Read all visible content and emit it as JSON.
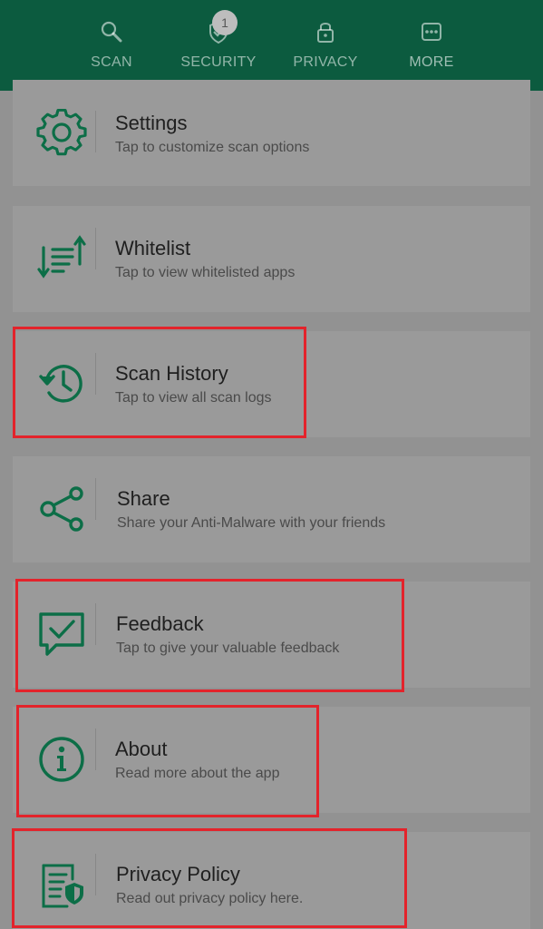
{
  "colors": {
    "accent": "#0c5b3f",
    "icon_green": "#0c6e47",
    "background_dimmed": "#929292",
    "highlight_red": "#e3232b"
  },
  "tabs": [
    {
      "label": "SCAN",
      "icon": "search-icon"
    },
    {
      "label": "SECURITY",
      "icon": "shield-check-icon",
      "badge": "1"
    },
    {
      "label": "PRIVACY",
      "icon": "lock-icon"
    },
    {
      "label": "MORE",
      "icon": "more-dots-icon",
      "active": true
    }
  ],
  "items": [
    {
      "title": "Settings",
      "subtitle": "Tap to customize scan options",
      "icon": "gear-icon",
      "highlighted": false
    },
    {
      "title": "Whitelist",
      "subtitle": "Tap to view whitelisted apps",
      "icon": "sort-list-icon",
      "highlighted": false
    },
    {
      "title": "Scan History",
      "subtitle": "Tap to view all scan logs",
      "icon": "history-icon",
      "highlighted": true
    },
    {
      "title": "Share",
      "subtitle": "Share your Anti-Malware with your friends",
      "icon": "share-icon",
      "highlighted": false
    },
    {
      "title": "Feedback",
      "subtitle": "Tap to give your valuable feedback",
      "icon": "feedback-icon",
      "highlighted": true
    },
    {
      "title": "About",
      "subtitle": "Read more about the app",
      "icon": "info-icon",
      "highlighted": true
    },
    {
      "title": "Privacy Policy",
      "subtitle": "Read out privacy policy here.",
      "icon": "policy-document-icon",
      "highlighted": true
    }
  ]
}
